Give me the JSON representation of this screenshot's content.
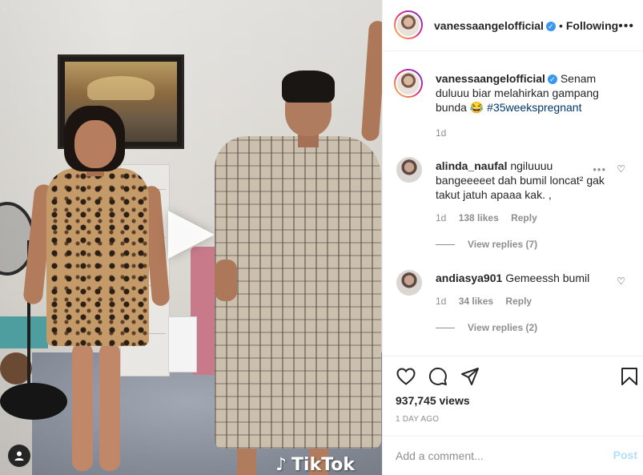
{
  "post": {
    "username": "vanessaangelofficial",
    "follow_state": "Following",
    "separator": "•",
    "caption_text": "Senam duluuu biar melahirkan gampang bunda 😂",
    "hashtag": "#35weekspregnant",
    "caption_age": "1d",
    "views": "937,745 views",
    "time_ago": "1 DAY AGO"
  },
  "video": {
    "watermark": "TikTok",
    "play_icon": "play-icon",
    "tag_icon": "user-tag-icon"
  },
  "comments": [
    {
      "username": "alinda_naufal",
      "text": "ngiluuuu bangeeeeet dah bumil loncat² gak takut jatuh apaaa kak. ,",
      "age": "1d",
      "likes": "138 likes",
      "reply_label": "Reply",
      "view_replies": "View replies (7)"
    },
    {
      "username": "andiasya901",
      "text": "Gemeessh bumil",
      "age": "1d",
      "likes": "34 likes",
      "reply_label": "Reply",
      "view_replies": "View replies (2)"
    }
  ],
  "add_comment": {
    "placeholder": "Add a comment...",
    "post_label": "Post"
  },
  "icons": [
    "heart-icon",
    "comment-icon",
    "share-icon",
    "bookmark-icon",
    "more-icon",
    "verified-icon"
  ],
  "colors": {
    "verified": "#3897f0",
    "hashtag": "#00376b",
    "muted": "#8e8e8e",
    "post_disabled": "#b2dffc"
  }
}
